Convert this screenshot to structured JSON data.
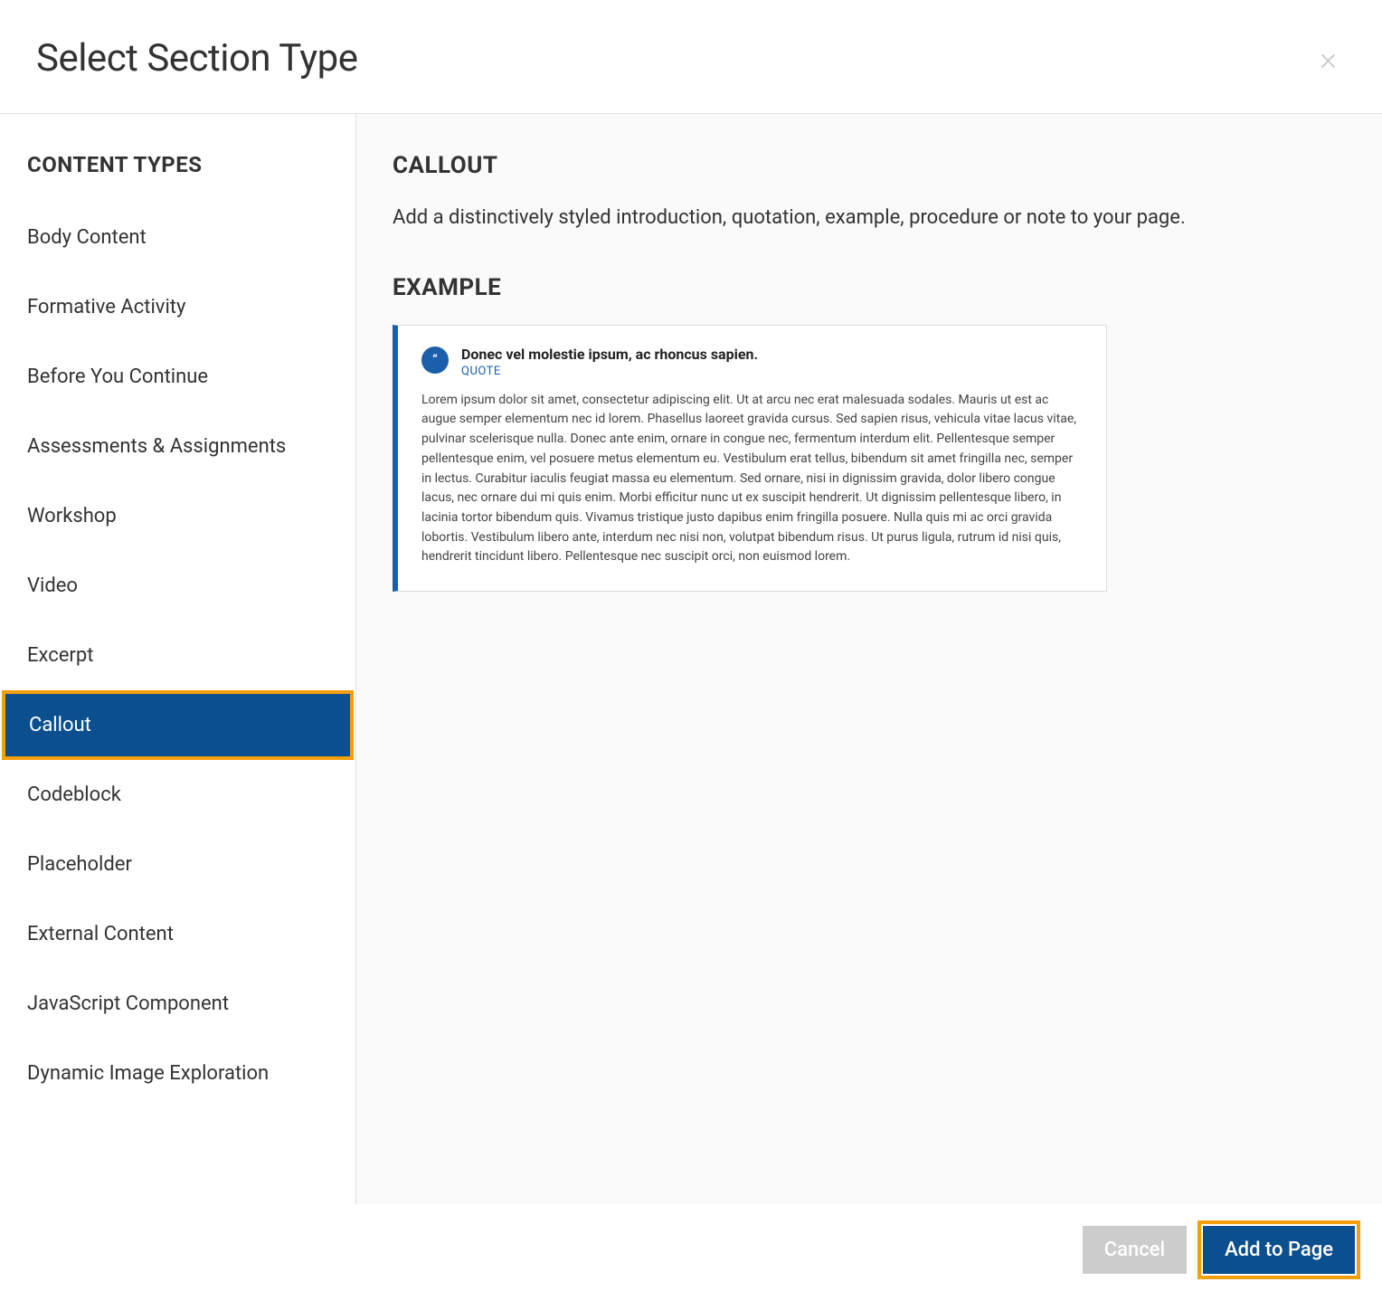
{
  "header": {
    "title": "Select Section Type"
  },
  "sidebar": {
    "heading": "CONTENT TYPES",
    "items": [
      {
        "label": "Body Content"
      },
      {
        "label": "Formative Activity"
      },
      {
        "label": "Before You Continue"
      },
      {
        "label": "Assessments & Assignments"
      },
      {
        "label": "Workshop"
      },
      {
        "label": "Video"
      },
      {
        "label": "Excerpt"
      },
      {
        "label": "Callout"
      },
      {
        "label": "Codeblock"
      },
      {
        "label": "Placeholder"
      },
      {
        "label": "External Content"
      },
      {
        "label": "JavaScript Component"
      },
      {
        "label": "Dynamic Image Exploration"
      }
    ],
    "selected_index": 7
  },
  "content": {
    "heading": "CALLOUT",
    "description": "Add a distinctively styled introduction, quotation, example, procedure or note to your page.",
    "example_heading": "EXAMPLE",
    "example": {
      "icon_glyph": "”",
      "title": "Donec vel molestie ipsum, ac rhoncus sapien.",
      "tag": "QUOTE",
      "body": "Lorem ipsum dolor sit amet, consectetur adipiscing elit. Ut at arcu nec erat malesuada sodales. Mauris ut est ac augue semper elementum nec id lorem. Phasellus laoreet gravida cursus. Sed sapien risus, vehicula vitae lacus vitae, pulvinar scelerisque nulla. Donec ante enim, ornare in congue nec, fermentum interdum elit. Pellentesque semper pellentesque enim, vel posuere metus elementum eu. Vestibulum erat tellus, bibendum sit amet fringilla nec, semper in lectus. Curabitur iaculis feugiat massa eu elementum. Sed ornare, nisi in dignissim gravida, dolor libero congue lacus, nec ornare dui mi quis enim. Morbi efficitur nunc ut ex suscipit hendrerit. Ut dignissim pellentesque libero, in lacinia tortor bibendum quis. Vivamus tristique justo dapibus enim fringilla posuere. Nulla quis mi ac orci gravida lobortis. Vestibulum libero ante, interdum nec nisi non, volutpat bibendum risus. Ut purus ligula, rutrum id nisi quis, hendrerit tincidunt libero. Pellentesque nec suscipit orci, non euismod lorem."
    }
  },
  "footer": {
    "cancel_label": "Cancel",
    "add_label": "Add to Page"
  }
}
